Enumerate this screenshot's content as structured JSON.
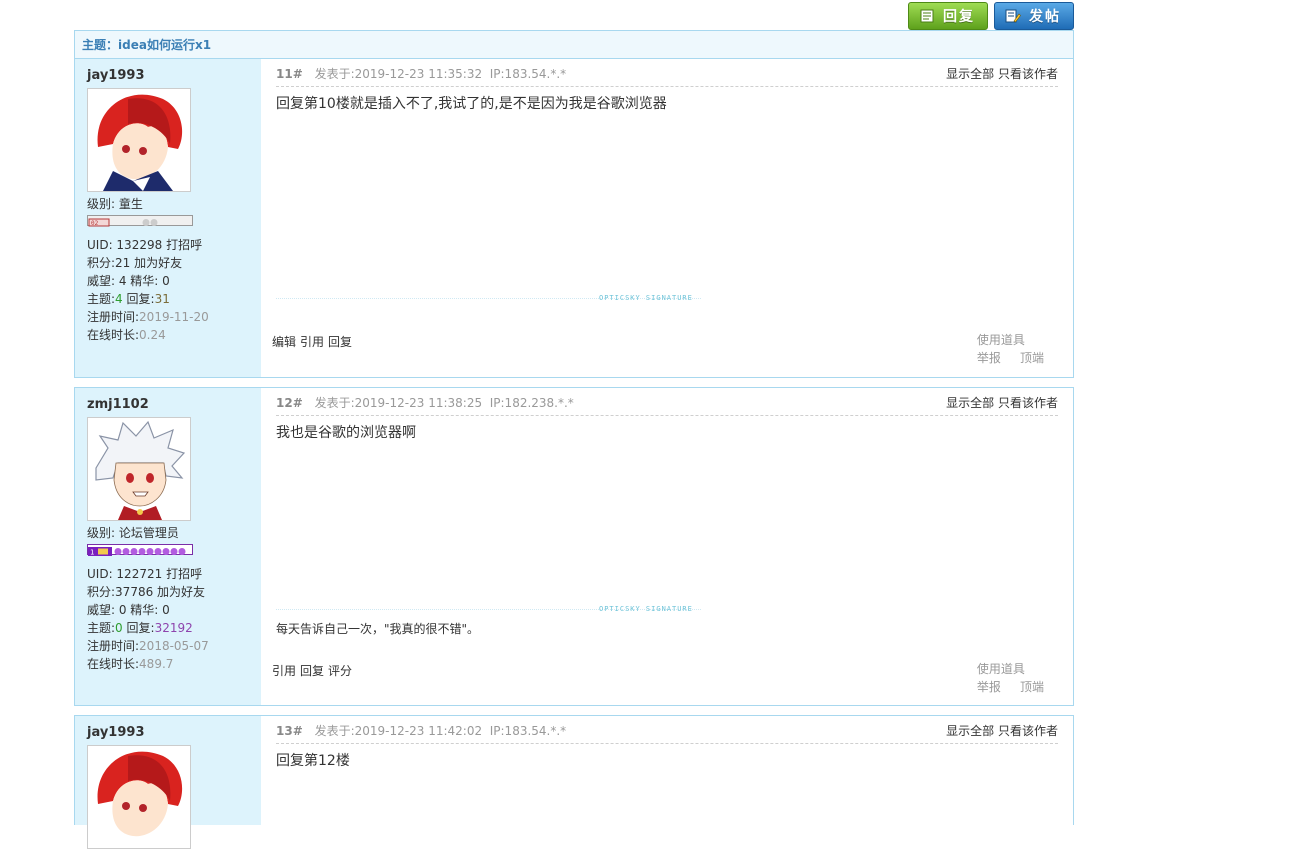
{
  "toolbar": {
    "reply_label": "回复",
    "post_label": "发帖"
  },
  "thread": {
    "subject_prefix": "主题：",
    "subject_title": "idea如何运行x1"
  },
  "posts": [
    {
      "floor": "11#",
      "posted_at": "发表于:2019-12-23 11:35:32",
      "ip": "IP:183.54.*.*",
      "show_all": "显示全部",
      "only_author": "只看该作者",
      "content": "回复第10楼就是插入不了,我试了的,是不是因为我是谷歌浏览器",
      "signature_tag": "OPTICSKY SIGNATURE",
      "signature_text": "",
      "actions": [
        "编辑",
        "引用",
        "回复"
      ],
      "tools": {
        "use": "使用道具",
        "report": "举报",
        "top": "顶端"
      },
      "user": {
        "name": "jay1993",
        "level_label": "级别: 童生",
        "uid_label": "UID: 132298",
        "greet": "打招呼",
        "points": "积分:21",
        "add_friend": "加为好友",
        "prestige": "威望: 4 精华: 0",
        "topics_label": "主题:",
        "topics": "4",
        "replies_label": "回复:",
        "replies": "31",
        "reg_label": "注册时间:",
        "reg": "2019-11-20",
        "online_label": "在线时长:",
        "online": "0.24"
      }
    },
    {
      "floor": "12#",
      "posted_at": "发表于:2019-12-23 11:38:25",
      "ip": "IP:182.238.*.*",
      "show_all": "显示全部",
      "only_author": "只看该作者",
      "content": "我也是谷歌的浏览器啊",
      "signature_tag": "OPTICSKY SIGNATURE",
      "signature_text": "每天告诉自己一次，\"我真的很不错\"。",
      "actions": [
        "引用",
        "回复",
        "评分"
      ],
      "tools": {
        "use": "使用道具",
        "report": "举报",
        "top": "顶端"
      },
      "user": {
        "name": "zmj1102",
        "level_label": "级别: 论坛管理员",
        "uid_label": "UID: 122721",
        "greet": "打招呼",
        "points": "积分:37786",
        "add_friend": "加为好友",
        "prestige": "威望: 0 精华: 0",
        "topics_label": "主题:",
        "topics": "0",
        "replies_label": "回复:",
        "replies": "32192",
        "reg_label": "注册时间:",
        "reg": "2018-05-07",
        "online_label": "在线时长:",
        "online": "489.7"
      }
    },
    {
      "floor": "13#",
      "posted_at": "发表于:2019-12-23 11:42:02",
      "ip": "IP:183.54.*.*",
      "show_all": "显示全部",
      "only_author": "只看该作者",
      "content": "回复第12楼",
      "user": {
        "name": "jay1993"
      }
    }
  ]
}
